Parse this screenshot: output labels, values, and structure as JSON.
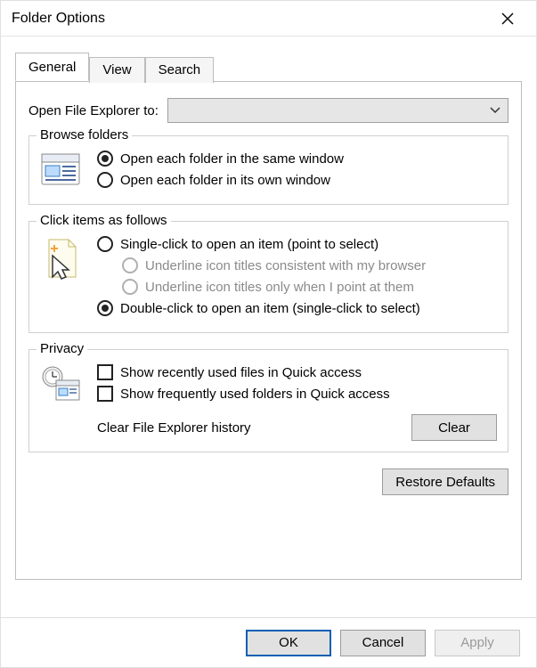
{
  "window": {
    "title": "Folder Options"
  },
  "tabs": [
    "General",
    "View",
    "Search"
  ],
  "active_tab": "General",
  "open_explorer": {
    "label": "Open File Explorer to:",
    "value": ""
  },
  "groups": {
    "browse": {
      "legend": "Browse folders",
      "opt_same": "Open each folder in the same window",
      "opt_own": "Open each folder in its own window",
      "selected": "same"
    },
    "click": {
      "legend": "Click items as follows",
      "opt_single": "Single-click to open an item (point to select)",
      "opt_single_sub1": "Underline icon titles consistent with my browser",
      "opt_single_sub2": "Underline icon titles only when I point at them",
      "opt_double": "Double-click to open an item (single-click to select)",
      "selected": "double"
    },
    "privacy": {
      "legend": "Privacy",
      "chk_recent_files": "Show recently used files in Quick access",
      "chk_frequent_folders": "Show frequently used folders in Quick access",
      "chk_recent_files_checked": false,
      "chk_frequent_folders_checked": false,
      "clear_label": "Clear File Explorer history",
      "clear_button": "Clear"
    }
  },
  "restore_defaults": "Restore Defaults",
  "buttons": {
    "ok": "OK",
    "cancel": "Cancel",
    "apply": "Apply"
  }
}
